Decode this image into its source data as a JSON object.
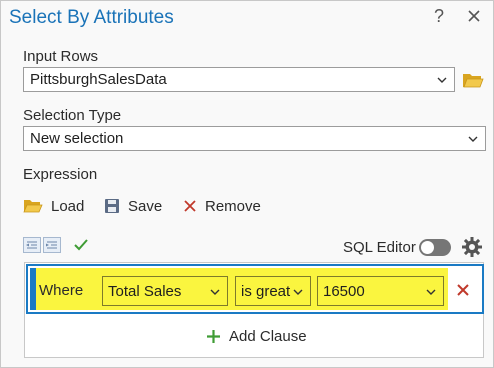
{
  "dialog": {
    "title": "Select By Attributes",
    "help_label": "?"
  },
  "input_rows": {
    "label": "Input Rows",
    "value": "PittsburghSalesData"
  },
  "selection_type": {
    "label": "Selection Type",
    "value": "New selection"
  },
  "expression": {
    "label": "Expression",
    "load_label": "Load",
    "save_label": "Save",
    "remove_label": "Remove",
    "sql_editor_label": "SQL Editor",
    "sql_editor_on": false
  },
  "clause": {
    "where_label": "Where",
    "field": "Total Sales",
    "operator": "is great",
    "value": "16500",
    "highlight_color": "#faf53f"
  },
  "add_clause_label": "Add Clause",
  "colors": {
    "accent": "#1a7ac4",
    "title": "#1a73b8",
    "remove_red": "#c0392b",
    "add_green": "#3f9c35"
  }
}
